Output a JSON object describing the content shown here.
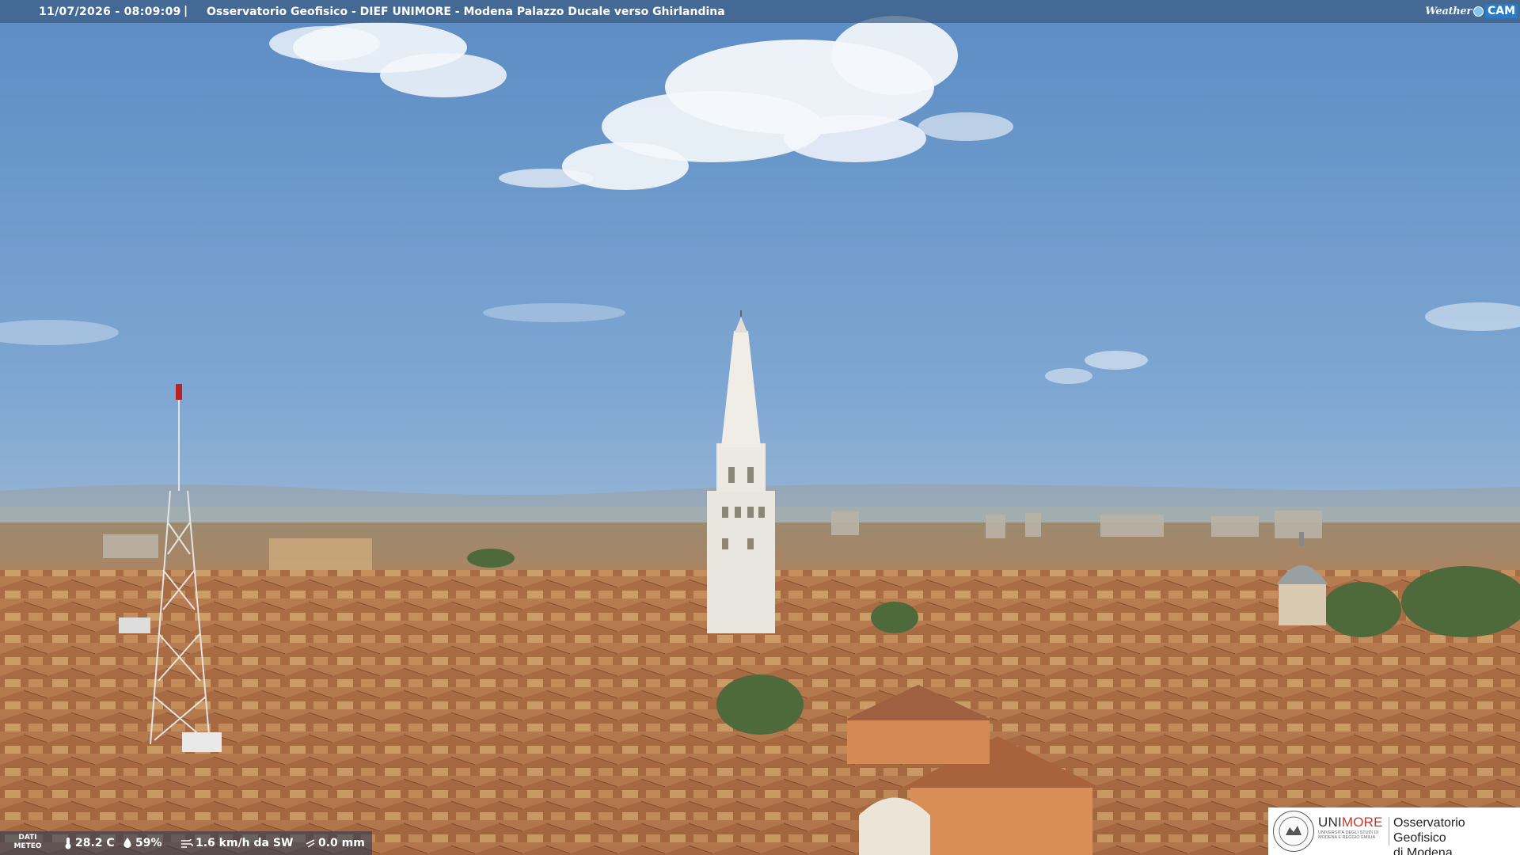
{
  "header": {
    "timestamp": "11/07/2026 - 08:09:09",
    "separator": "|",
    "title": "Osservatorio Geofisico - DIEF UNIMORE - Modena Palazzo Ducale verso Ghirlandina"
  },
  "brand": {
    "weather_text": "Weather",
    "cam_text": "CAM"
  },
  "weather": {
    "label_line1": "DATI",
    "label_line2": "METEO",
    "temperature": "28.2 C",
    "humidity": "59%",
    "wind": "1.6 km/h da SW",
    "rain": "0.0 mm",
    "icons": [
      "thermometer-icon",
      "humidity-drop-icon",
      "wind-icon",
      "rain-icon"
    ]
  },
  "logo": {
    "uni_prefix": "UNI",
    "uni_suffix": "MORE",
    "university_line1": "UNIVERSITÀ DEGLI STUDI DI",
    "university_line2": "MODENA E REGGIO EMILIA",
    "observatory_line1": "Osservatorio Geofisico",
    "observatory_line2": "di Modena"
  },
  "colors": {
    "header_bar": "#3c5c82",
    "sky_top": "#5e8fc6",
    "roof": "#b8764a",
    "accent_red": "#c0392b"
  }
}
